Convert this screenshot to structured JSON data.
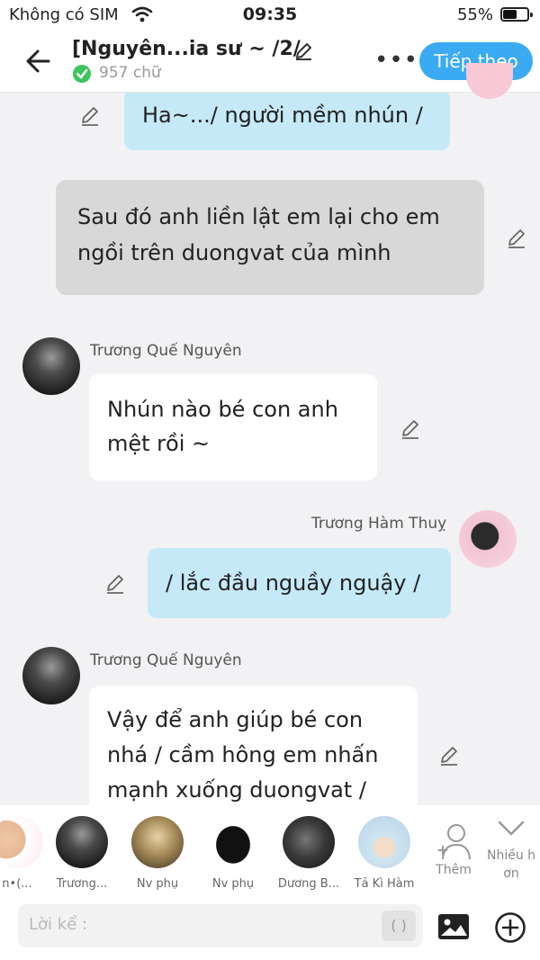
{
  "status_bar": {
    "carrier": "Không có SIM",
    "time": "09:35",
    "battery": "55%",
    "battery_level": 0.55
  },
  "header": {
    "title": "[Nguyên...ia sư ~ /2/",
    "word_count": "957 chữ",
    "next_label": "Tiếp theo"
  },
  "messages": [
    {
      "text": "Ha~.../ người mềm nhún /"
    },
    {
      "text": "Sau đó anh liền lật em lại cho em ngồi trên duongvat của mình",
      "line1": "Sau đó anh liền lật em lại cho em",
      "line2": "ngồi trên duongvat của mình"
    },
    {
      "sender": "Trương Quế Nguyên",
      "line1": "Nhún nào bé con anh",
      "line2": "mệt rồi ~"
    },
    {
      "sender": "Trương Hàm Thuỵ",
      "line1": "/ lắc đầu nguầy nguậy /"
    },
    {
      "sender": "Trương Quế Nguyên",
      "line1": "Vậy để anh giúp bé con",
      "line2": "nhá / cầm hông em nhấn",
      "line3": "mạnh xuống duongvat /"
    }
  ],
  "characters": [
    {
      "label": "n•(..."
    },
    {
      "label": "Trương..."
    },
    {
      "label": "Nv phụ"
    },
    {
      "label": "Nv phụ"
    },
    {
      "label": "Dương B..."
    },
    {
      "label": "Tả Kì Hàm"
    }
  ],
  "add_more_label": "Thêm",
  "more_options_label_1": "Nhiều h",
  "more_options_label_2": "ơn",
  "input": {
    "placeholder": "Lời kể :",
    "paren": "( )"
  },
  "colors": {
    "accent": "#3aaaf3",
    "blue_bubble": "#c6e9f8",
    "gray_bubble": "#d8d8d8",
    "verified": "#3ec45c"
  }
}
